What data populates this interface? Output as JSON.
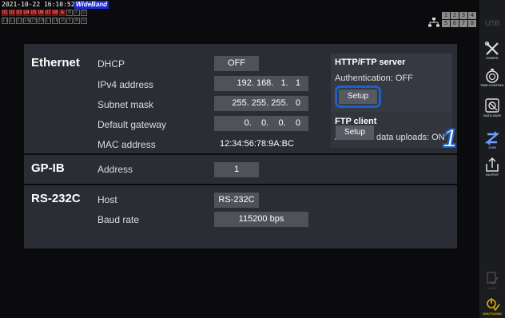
{
  "status": {
    "datetime": "2021-10-22 16:10:52",
    "mode_badge": "WideBand",
    "channels_row1": [
      "U1",
      "U2",
      "U3",
      "U4",
      "U5",
      "U6",
      "U7",
      "U8"
    ],
    "channels_row1_right": [
      "A",
      "B",
      "C",
      "D"
    ],
    "channels_row2": [
      "I1",
      "I2",
      "I3",
      "I4",
      "I5",
      "I6",
      "I7",
      "I8"
    ],
    "channels_row2_right": [
      "U",
      "V",
      "W",
      "U"
    ],
    "slots": [
      "1",
      "2",
      "3",
      "4",
      "5",
      "6",
      "7",
      "8"
    ]
  },
  "sidebar": {
    "usb_label": "USB",
    "items": [
      {
        "label": "CONFIG",
        "icon": "wrench-screwdriver-icon"
      },
      {
        "label": "TIME CONTROL",
        "icon": "timer-icon"
      },
      {
        "label": "DATA SAVE",
        "icon": "data-save-icon"
      },
      {
        "label": "COM",
        "icon": "com-icon",
        "active": true
      },
      {
        "label": "OUTPUT",
        "icon": "output-icon"
      },
      {
        "label": "LOCK",
        "icon": "lock-icon"
      },
      {
        "label": "SHUTDOWN",
        "icon": "shutdown-icon"
      }
    ]
  },
  "ethernet": {
    "title": "Ethernet",
    "dhcp_label": "DHCP",
    "dhcp_value": "OFF",
    "ipv4_label": "IPv4 address",
    "ipv4_value": "192. 168.   1.   1",
    "subnet_label": "Subnet mask",
    "subnet_value": "255. 255. 255.   0",
    "gateway_label": "Default gateway",
    "gateway_value": "0.    0.    0.    0",
    "mac_label": "MAC address",
    "mac_value": "12:34:56:78:9A:BC",
    "http_ftp": {
      "title": "HTTP/FTP server",
      "auth_text": "Authentication: OFF",
      "setup_label": "Setup"
    },
    "ftp_client": {
      "title": "FTP client",
      "auto_text": "Automatic data uploads: ON",
      "setup_label": "Setup"
    }
  },
  "gpib": {
    "title": "GP-IB",
    "address_label": "Address",
    "address_value": "1"
  },
  "rs232c": {
    "title": "RS-232C",
    "host_label": "Host",
    "host_value": "RS-232C",
    "baud_label": "Baud rate",
    "baud_value": "115200 bps"
  },
  "callout": "1",
  "colors": {
    "accent": "#1d62c9",
    "panel": "#2a2d33",
    "field": "#4f5258",
    "channel_red": "#7a1212"
  }
}
